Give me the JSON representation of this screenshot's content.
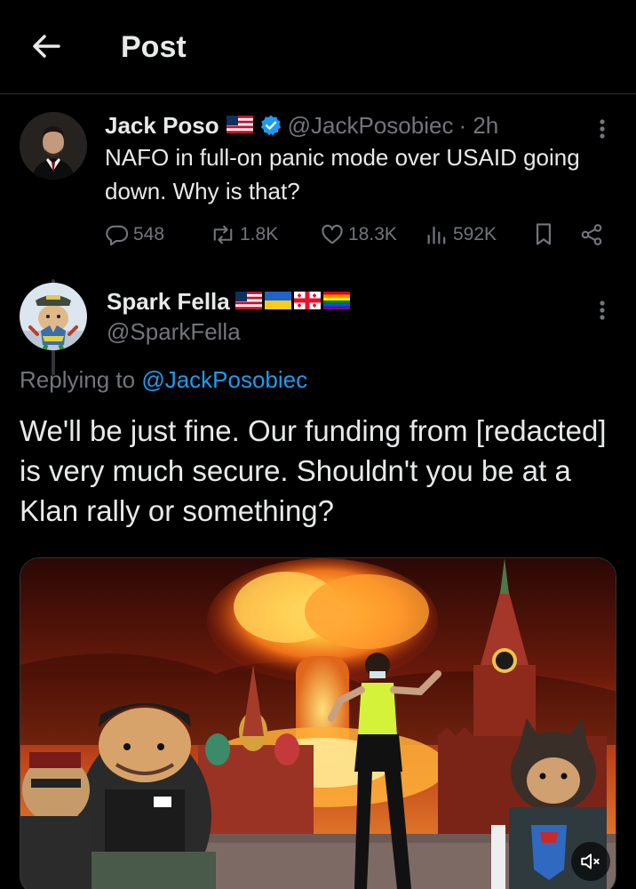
{
  "header": {
    "title": "Post"
  },
  "original_post": {
    "display_name": "Jack Poso",
    "handle": "@JackPosobiec",
    "time": "· 2h",
    "text": "NAFO in full-on panic mode over USAID going down. Why is that?",
    "replies": "548",
    "reposts": "1.8K",
    "likes": "18.3K",
    "views": "592K"
  },
  "reply_post": {
    "display_name": "Spark Fella",
    "handle": "@SparkFella",
    "replying_prefix": "Replying to",
    "replying_to": "@JackPosobiec",
    "text": "We'll be just fine. Our funding from [redacted] is very much secure. Shouldn't you be at a Klan rally or something?"
  },
  "colors": {
    "background": "#000000",
    "text": "#e7e9ea",
    "muted": "#71767b",
    "link": "#1d9bf0",
    "verified": "#1d9bf0",
    "divider": "#2f3336"
  },
  "icons": [
    "back-arrow-icon",
    "verified-badge-icon",
    "more-icon",
    "reply-icon",
    "repost-icon",
    "like-icon",
    "views-icon",
    "bookmark-icon",
    "share-icon",
    "mute-icon"
  ]
}
